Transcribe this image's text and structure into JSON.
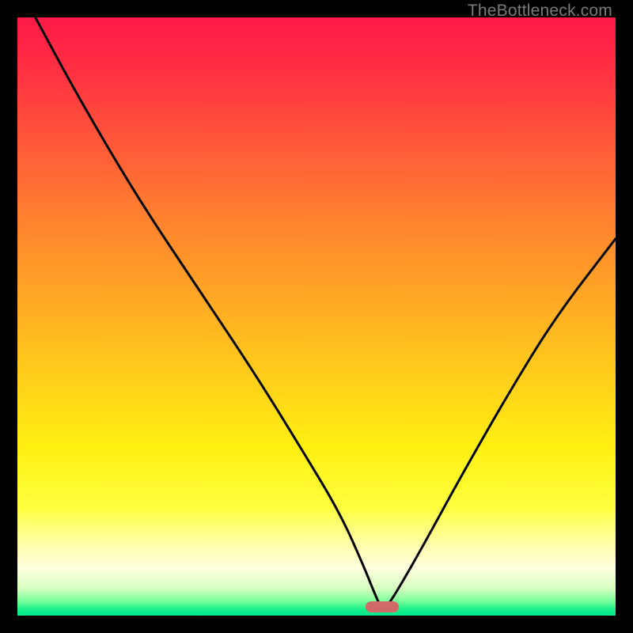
{
  "watermark": {
    "text": "TheBottleneck.com"
  },
  "colors": {
    "gradient_stops": [
      {
        "offset": 0,
        "color": "#FF1A47"
      },
      {
        "offset": 0.07,
        "color": "#FF2A44"
      },
      {
        "offset": 0.18,
        "color": "#FF4E3B"
      },
      {
        "offset": 0.32,
        "color": "#FF7C30"
      },
      {
        "offset": 0.46,
        "color": "#FFA525"
      },
      {
        "offset": 0.6,
        "color": "#FFCE1B"
      },
      {
        "offset": 0.72,
        "color": "#FFF011"
      },
      {
        "offset": 0.82,
        "color": "#FFFF40"
      },
      {
        "offset": 0.88,
        "color": "#FFFFA8"
      },
      {
        "offset": 0.92,
        "color": "#FFFFE0"
      },
      {
        "offset": 0.955,
        "color": "#D6FFC0"
      },
      {
        "offset": 0.975,
        "color": "#7CFF9A"
      },
      {
        "offset": 0.99,
        "color": "#19F08C"
      },
      {
        "offset": 1.0,
        "color": "#00E88F"
      }
    ],
    "curve": "#000000",
    "marker": "#CF6A66",
    "background": "#000000"
  },
  "chart_data": {
    "type": "line",
    "title": "",
    "xlabel": "",
    "ylabel": "",
    "xlim": [
      0,
      100
    ],
    "ylim": [
      0,
      100
    ],
    "grid": false,
    "notes": "Bottleneck-style V curve. y≈0 near x≈61; rises toward 100 at x→0 and toward ~62 at x→100. Marker pill at approx (61, 1.5).",
    "series": [
      {
        "name": "curve",
        "x": [
          3,
          10,
          20,
          30,
          40,
          48,
          54,
          58,
          60,
          61,
          62,
          64,
          68,
          74,
          82,
          90,
          100
        ],
        "values": [
          100,
          87,
          70,
          55,
          40,
          27,
          17,
          8,
          3,
          1,
          1.8,
          5,
          12,
          23,
          37,
          50,
          63
        ]
      }
    ],
    "marker": {
      "x": 61,
      "y": 1.5
    }
  }
}
